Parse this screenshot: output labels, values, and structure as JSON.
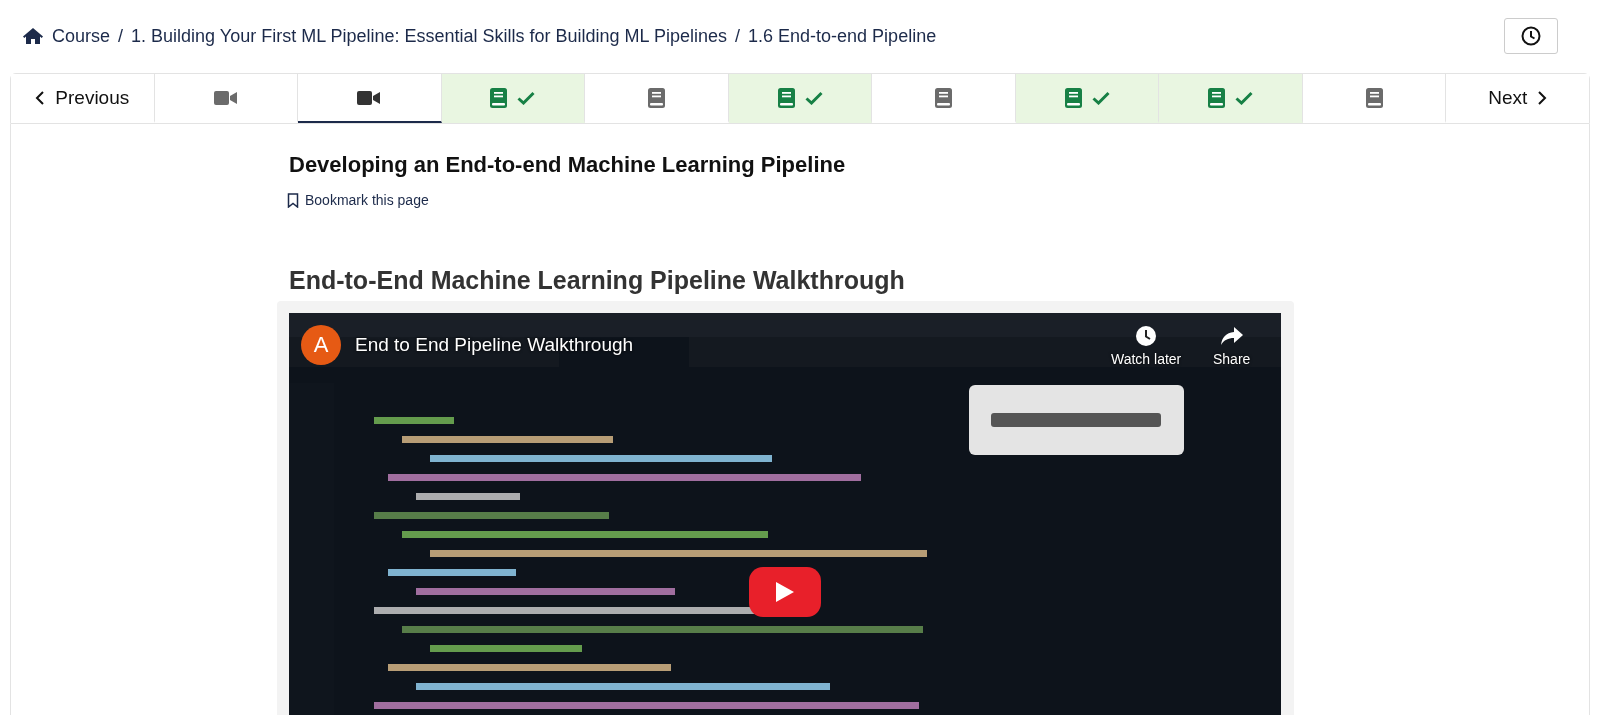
{
  "breadcrumb": [
    {
      "label": "Course",
      "kind": "home"
    },
    {
      "separator": "/",
      "label": "1. Building Your First ML Pipeline: Essential Skills for Building ML Pipelines",
      "kind": "link"
    },
    {
      "separator": "/",
      "label": "1.6 End-to-end Pipeline",
      "kind": "current"
    }
  ],
  "previous": "Previous",
  "next": "Next",
  "units": [
    {
      "kind": "video",
      "completed": false,
      "selected": false
    },
    {
      "kind": "video",
      "completed": false,
      "selected": true
    },
    {
      "kind": "reading",
      "completed": true,
      "selected": false
    },
    {
      "kind": "reading",
      "completed": false,
      "selected": false
    },
    {
      "kind": "reading",
      "completed": true,
      "selected": false
    },
    {
      "kind": "reading",
      "completed": false,
      "selected": false
    },
    {
      "kind": "reading",
      "completed": true,
      "selected": false
    },
    {
      "kind": "reading",
      "completed": true,
      "selected": false
    },
    {
      "kind": "reading",
      "completed": false,
      "selected": false
    }
  ],
  "page_title": "Developing an End-to-end Machine Learning Pipeline",
  "bookmark": "Bookmark this page",
  "section_title": "End-to-End Machine Learning Pipeline Walkthrough",
  "video": {
    "avatar": "A",
    "title": "End to End Pipeline Walkthrough",
    "watch_later": "Watch later",
    "share": "Share"
  }
}
